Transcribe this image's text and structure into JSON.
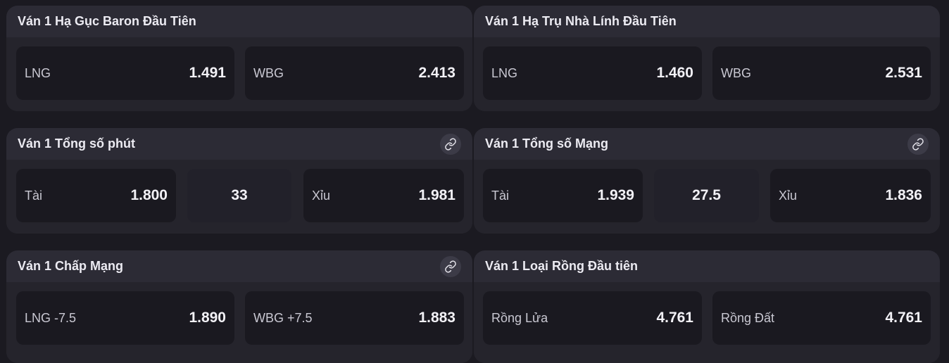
{
  "markets": [
    {
      "title": "Ván 1 Hạ Gục Baron Đầu Tiên",
      "options": [
        {
          "label": "LNG",
          "odds": "1.491"
        },
        {
          "label": "WBG",
          "odds": "2.413"
        }
      ]
    },
    {
      "title": "Ván 1 Hạ Trụ Nhà Lính Đầu Tiên",
      "options": [
        {
          "label": "LNG",
          "odds": "1.460"
        },
        {
          "label": "WBG",
          "odds": "2.531"
        }
      ]
    },
    {
      "title": "Ván 1 Tổng số phút",
      "link_icon": "link-icon",
      "line": "33",
      "options": [
        {
          "label": "Tài",
          "odds": "1.800"
        },
        {
          "label": "Xỉu",
          "odds": "1.981"
        }
      ]
    },
    {
      "title": "Ván 1 Tổng số Mạng",
      "link_icon": "link-icon",
      "line": "27.5",
      "options": [
        {
          "label": "Tài",
          "odds": "1.939"
        },
        {
          "label": "Xỉu",
          "odds": "1.836"
        }
      ]
    },
    {
      "title": "Ván 1 Chấp Mạng",
      "link_icon": "link-icon",
      "options": [
        {
          "label": "LNG -7.5",
          "odds": "1.890"
        },
        {
          "label": "WBG +7.5",
          "odds": "1.883"
        }
      ]
    },
    {
      "title": "Ván 1 Loại Rồng Đầu tiên",
      "options": [
        {
          "label": "Rồng Lửa",
          "odds": "4.761"
        },
        {
          "label": "Rồng Đất",
          "odds": "4.761"
        }
      ]
    }
  ]
}
